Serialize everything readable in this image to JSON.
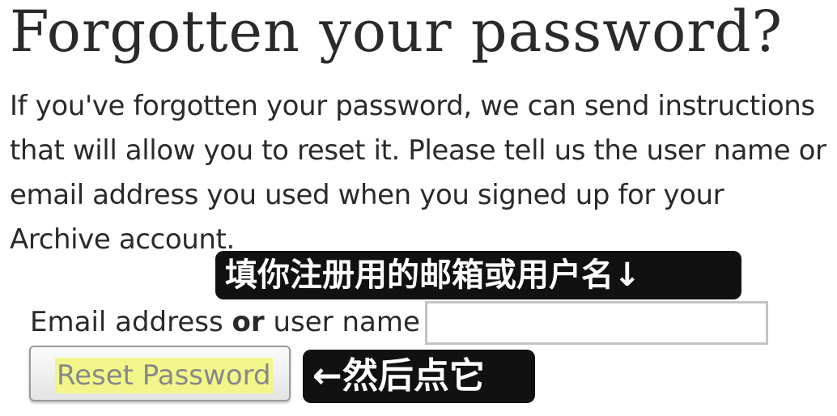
{
  "page": {
    "title": "Forgotten your password?",
    "intro": "If you've forgotten your password, we can send instructions that will allow you to reset it. Please tell us the user name or email address you used when you signed up for your Archive account."
  },
  "form": {
    "label_part1": "Email address ",
    "label_bold": "or",
    "label_part2": " user name",
    "input_value": "",
    "submit_label": "Reset Password"
  },
  "annotations": {
    "input_hint": "填你注册用的邮箱或用户名↓",
    "button_hint": "←然后点它"
  },
  "colors": {
    "button_highlight": "#f2f68a",
    "annotation_background": "#111111"
  }
}
